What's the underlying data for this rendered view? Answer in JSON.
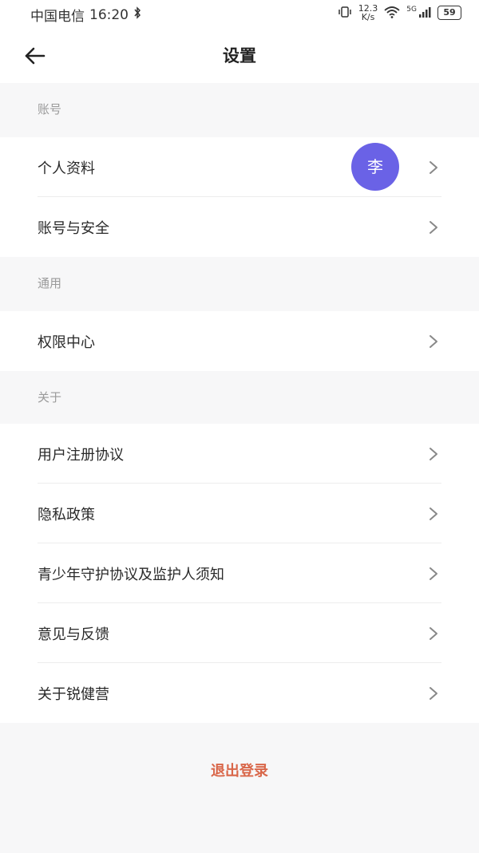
{
  "status_bar": {
    "carrier": "中国电信",
    "time": "16:20",
    "net_speed_value": "12.3",
    "net_speed_unit": "K/s",
    "signal_label": "5G",
    "battery": "59"
  },
  "header": {
    "title": "设置"
  },
  "sections": {
    "account": {
      "title": "账号",
      "items": [
        {
          "label": "个人资料",
          "avatar_text": "李"
        },
        {
          "label": "账号与安全"
        }
      ]
    },
    "general": {
      "title": "通用",
      "items": [
        {
          "label": "权限中心"
        }
      ]
    },
    "about": {
      "title": "关于",
      "items": [
        {
          "label": "用户注册协议"
        },
        {
          "label": "隐私政策"
        },
        {
          "label": "青少年守护协议及监护人须知"
        },
        {
          "label": "意见与反馈"
        },
        {
          "label": "关于锐健营"
        }
      ]
    }
  },
  "logout_label": "退出登录",
  "colors": {
    "avatar": "#6a62e6",
    "logout": "#d9674a",
    "section_bg": "#f7f7f8"
  }
}
